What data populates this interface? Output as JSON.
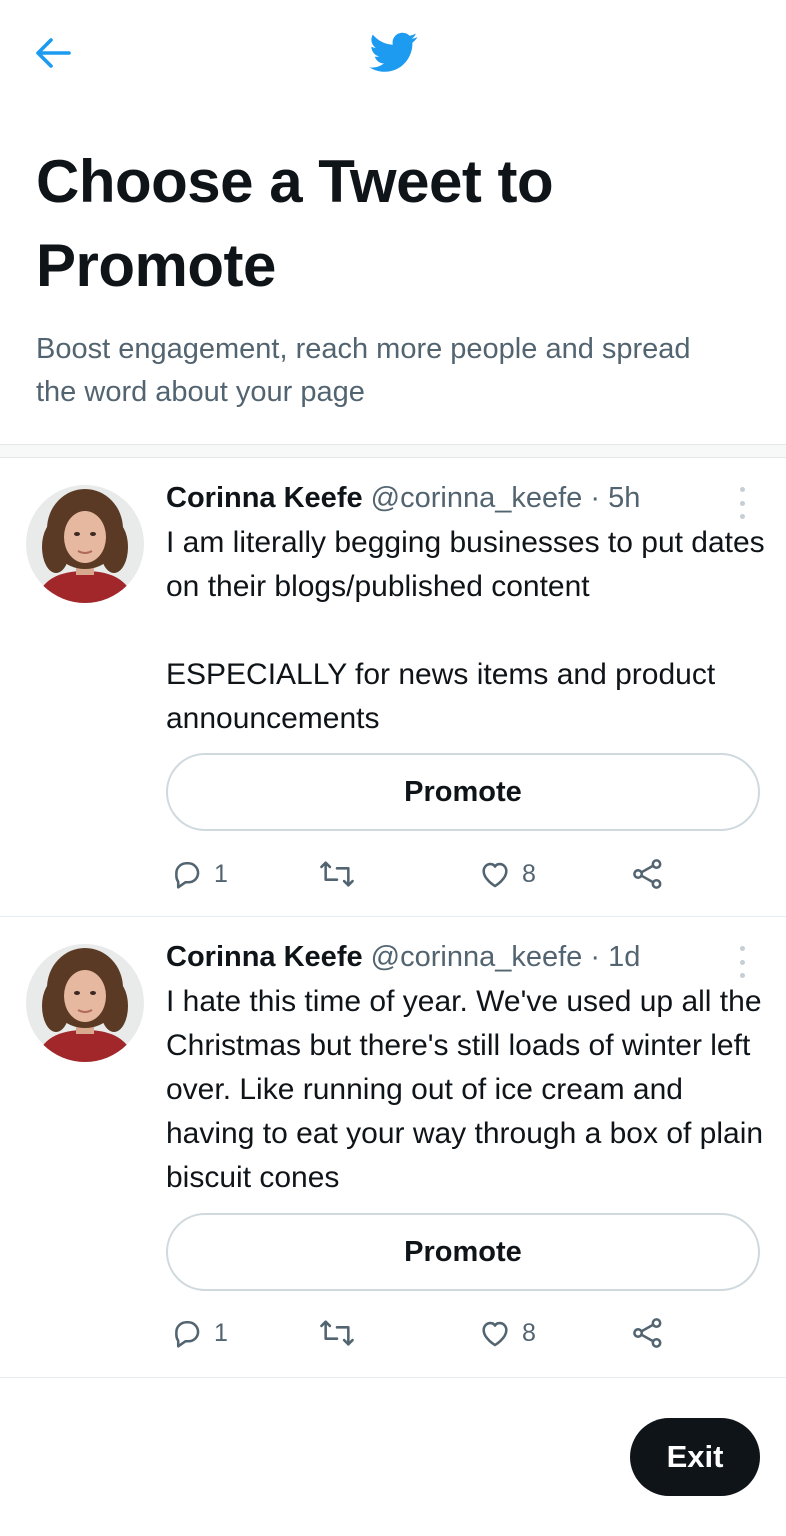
{
  "header": {
    "back_icon": "arrow-left-icon",
    "logo_icon": "twitter-bird-icon",
    "accent_color": "#1d9bf0"
  },
  "page": {
    "title": "Choose a Tweet to Promote",
    "subtitle": "Boost engagement, reach more people and spread the word about your page"
  },
  "tweets": [
    {
      "name": "Corinna Keefe",
      "handle": "@corinna_keefe",
      "meta": "@corinna_keefe · 5h",
      "age": "5h",
      "text": "I am literally begging businesses to put dates on their blogs/published content\n\nESPECIALLY for news items and product announcements",
      "promote_label": "Promote",
      "replies": "1",
      "likes": "8"
    },
    {
      "name": "Corinna Keefe",
      "handle": "@corinna_keefe",
      "meta": "@corinna_keefe · 1d",
      "age": "1d",
      "text": "I hate this time of year. We've used up all the Christmas but there's still loads of winter left over. Like running out of ice cream and having to eat your way through a box of plain biscuit cones",
      "promote_label": "Promote",
      "replies": "1",
      "likes": "8"
    }
  ],
  "footer": {
    "exit_label": "Exit"
  }
}
